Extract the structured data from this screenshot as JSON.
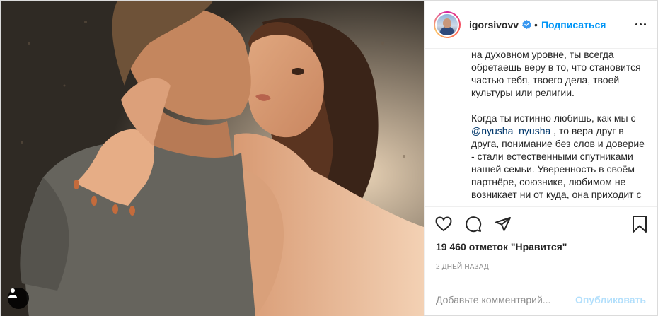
{
  "header": {
    "username": "igorsivovv",
    "separator": "•",
    "follow_label": "Подписаться",
    "verified_icon": "verified-badge-icon",
    "more_icon": "more-options-icon",
    "colors": {
      "follow": "#0095f6",
      "verified": "#3897f0"
    }
  },
  "caption": {
    "paragraph1": "на духовном уровне, ты всегда обретаешь веру в то, что становится частью тебя, твоего дела, твоей культуры или религии.",
    "paragraph2_before": "Когда ты истинно любишь, как мы с ",
    "mention": "@nyusha_nyusha",
    "paragraph2_after": " , то вера друг в друга, понимание без слов и доверие - стали естественными спутниками нашей семьи. Уверенность в своём партнёре, союзнике, любимом не возникает ни от куда, она приходит с"
  },
  "actions": {
    "like_icon": "heart-icon",
    "comment_icon": "comment-icon",
    "share_icon": "share-icon",
    "save_icon": "bookmark-icon"
  },
  "likes": {
    "text": "19 460 отметок \"Нравится\""
  },
  "time": {
    "text": "2 дней назад"
  },
  "comment": {
    "placeholder": "Добавьте комментарий...",
    "publish_label": "Опубликовать",
    "publish_color": "#b2dffc"
  },
  "photo": {
    "user_tags_icon": "user-tags-icon"
  }
}
